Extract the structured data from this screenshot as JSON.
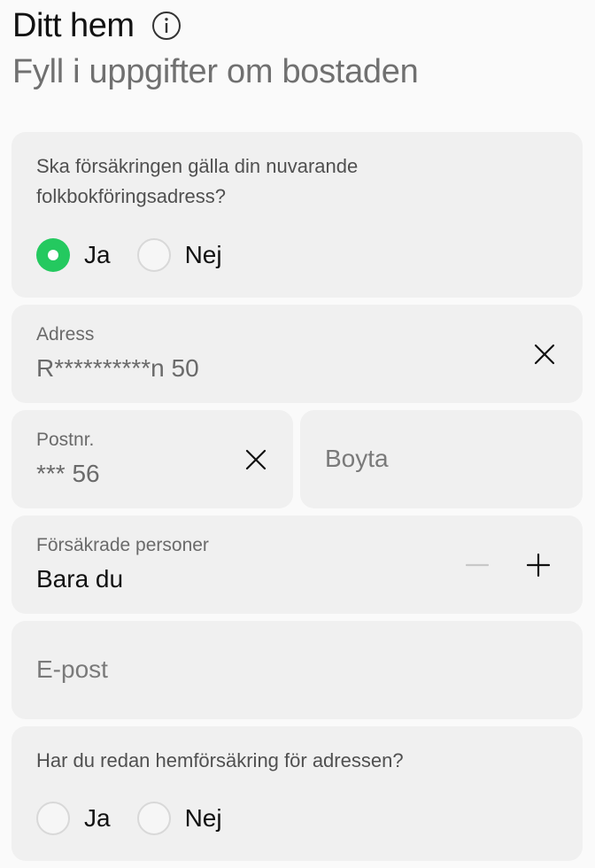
{
  "header": {
    "title": "Ditt hem",
    "subtitle": "Fyll i uppgifter om bostaden"
  },
  "registered_address": {
    "question_line1": "Ska försäkringen gälla din nuvarande",
    "question_line2": "folkbokföringsadress?",
    "options": [
      {
        "label": "Ja",
        "selected": true
      },
      {
        "label": "Nej",
        "selected": false
      }
    ]
  },
  "address": {
    "label": "Adress",
    "value": "R**********n 50"
  },
  "postal_code": {
    "label": "Postnr.",
    "value": "*** 56"
  },
  "living_area": {
    "placeholder": "Boyta"
  },
  "insured_persons": {
    "label": "Försäkrade personer",
    "value": "Bara du"
  },
  "email": {
    "placeholder": "E-post"
  },
  "existing_insurance": {
    "question": "Har du redan hemförsäkring för adressen?",
    "options": [
      {
        "label": "Ja",
        "selected": false
      },
      {
        "label": "Nej",
        "selected": false
      }
    ]
  },
  "colors": {
    "accent": "#24c95f",
    "card": "#f0f0f0",
    "background": "#fafafa"
  }
}
